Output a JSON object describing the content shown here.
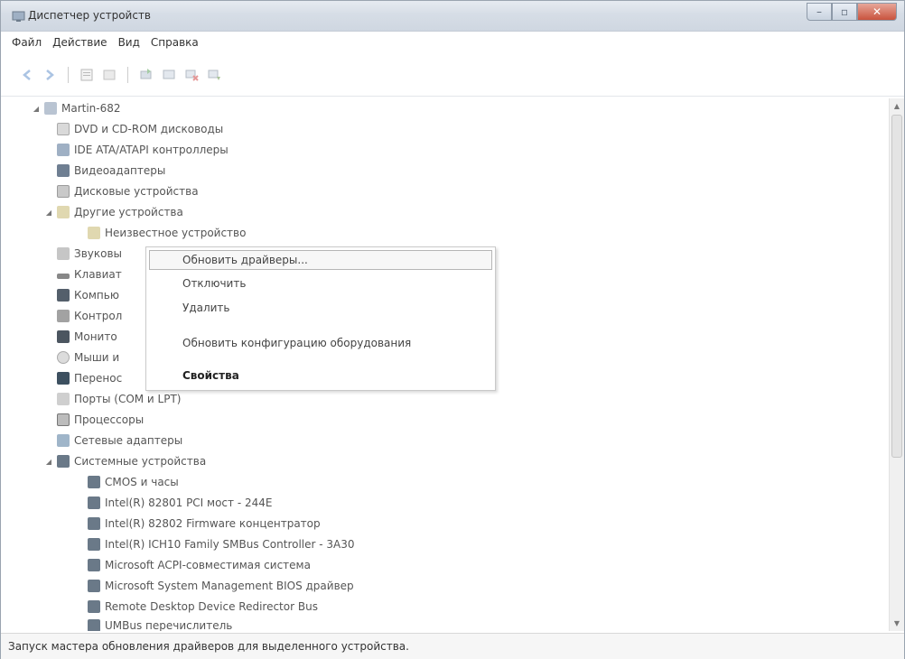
{
  "window": {
    "title": "Диспетчер устройств"
  },
  "menubar": {
    "items": [
      "Файл",
      "Действие",
      "Вид",
      "Справка"
    ]
  },
  "toolbar": {
    "icons": [
      "back-icon",
      "forward-icon",
      "properties-icon",
      "show-hidden-icon",
      "update-driver-icon",
      "scan-icon",
      "disable-icon",
      "uninstall-icon"
    ]
  },
  "tree": {
    "root": "Martin-682",
    "items": [
      {
        "label": "DVD и CD-ROM дисководы"
      },
      {
        "label": "IDE ATA/ATAPI контроллеры"
      },
      {
        "label": "Видеоадаптеры"
      },
      {
        "label": "Дисковые устройства"
      },
      {
        "label": "Другие устройства",
        "expanded": true
      },
      {
        "label": "Неизвестное устройство",
        "child": true
      },
      {
        "label": "Звуковы"
      },
      {
        "label": "Клавиат"
      },
      {
        "label": "Компью"
      },
      {
        "label": "Контрол"
      },
      {
        "label": "Монито"
      },
      {
        "label": "Мыши и"
      },
      {
        "label": "Перенос"
      },
      {
        "label": "Порты (COM и LPT)"
      },
      {
        "label": "Процессоры"
      },
      {
        "label": "Сетевые адаптеры"
      },
      {
        "label": "Системные устройства",
        "expanded": true
      },
      {
        "label": "CMOS и часы",
        "child": true
      },
      {
        "label": "Intel(R) 82801 PCI мост - 244E",
        "child": true
      },
      {
        "label": "Intel(R) 82802 Firmware концентратор",
        "child": true
      },
      {
        "label": "Intel(R) ICH10 Family SMBus Controller - 3A30",
        "child": true
      },
      {
        "label": "Microsoft ACPI-совместимая система",
        "child": true
      },
      {
        "label": "Microsoft System Management BIOS драйвер",
        "child": true
      },
      {
        "label": "Remote Desktop Device Redirector Bus",
        "child": true
      },
      {
        "label": "UMBus перечислитель",
        "child": true
      }
    ]
  },
  "context_menu": {
    "items": [
      {
        "label": "Обновить драйверы...",
        "hover": true
      },
      {
        "label": "Отключить"
      },
      {
        "label": "Удалить"
      },
      {
        "label": "Обновить конфигурацию оборудования"
      },
      {
        "label": "Свойства",
        "bold": true
      }
    ]
  },
  "statusbar": {
    "text": "Запуск мастера обновления драйверов для выделенного устройства."
  }
}
